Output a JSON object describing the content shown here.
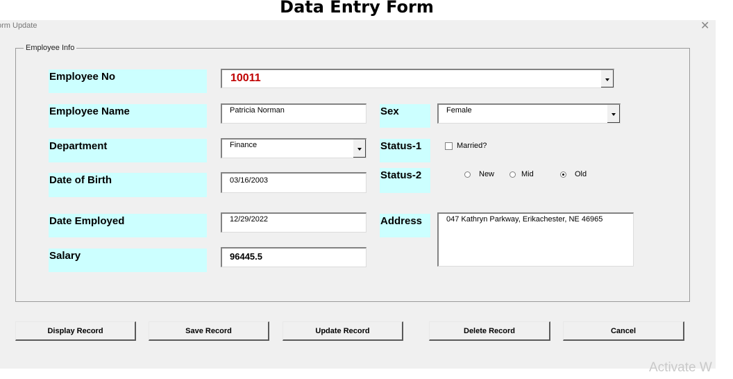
{
  "page": {
    "title": "Data Entry Form"
  },
  "window": {
    "title": "orm Update",
    "close_label": "✕"
  },
  "frame": {
    "caption": "Employee Info"
  },
  "labels": {
    "employee_no": "Employee No",
    "employee_name": "Employee Name",
    "department": "Department",
    "date_of_birth": "Date of Birth",
    "date_employed": "Date Employed",
    "salary": "Salary",
    "sex": "Sex",
    "status1": "Status-1",
    "status2": "Status-2",
    "address": "Address"
  },
  "fields": {
    "employee_no": "10011",
    "employee_name": "Patricia Norman",
    "department": "Finance",
    "date_of_birth": "03/16/2003",
    "date_employed": "12/29/2022",
    "salary": "96445.5",
    "sex": "Female",
    "address": "047 Kathryn Parkway, Erikachester, NE 46965"
  },
  "status1": {
    "label": "Married?",
    "checked": false
  },
  "status2": {
    "options": [
      {
        "label": "New",
        "selected": false
      },
      {
        "label": "Mid",
        "selected": false
      },
      {
        "label": "Old",
        "selected": true
      }
    ]
  },
  "buttons": {
    "display": "Display Record",
    "save": "Save Record",
    "update": "Update Record",
    "delete": "Delete Record",
    "cancel": "Cancel"
  },
  "watermark": "Activate W",
  "colors": {
    "label_bg": "#ccffff",
    "emp_no_text": "#c00000",
    "form_bg": "#f0f0f0"
  }
}
